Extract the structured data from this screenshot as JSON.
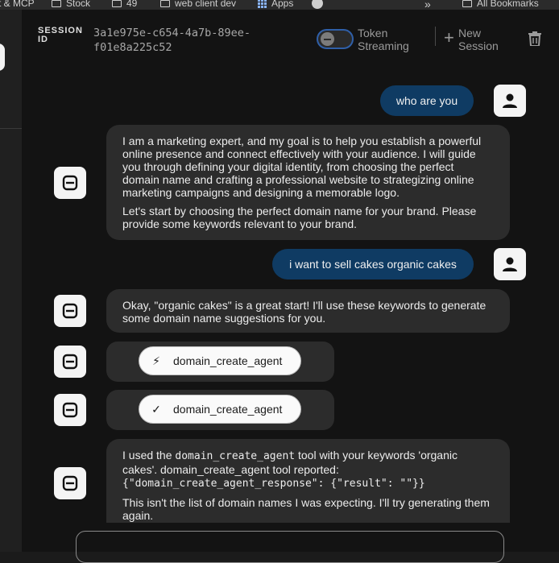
{
  "bookmarks": {
    "items": [
      {
        "label": "t & MCP"
      },
      {
        "label": "Stock"
      },
      {
        "label": "49"
      },
      {
        "label": "web client dev"
      },
      {
        "label": "Apps"
      }
    ],
    "overflow": "»",
    "all": "All Bookmarks"
  },
  "header": {
    "session_label": "SESSION ID",
    "session_id": "3a1e975e-c654-4a7b-89ee-f01e8a225c52",
    "token_streaming_label": "Token Streaming",
    "token_streaming_on": false,
    "new_session_label": "New Session",
    "accent": "#2f5fa8"
  },
  "messages": {
    "m1_user": "who are you",
    "m2_bot_p1": "I am a marketing expert, and my goal is to help you establish a powerful online presence and connect effectively with your audience. I will guide you through defining your digital identity, from choosing the perfect domain name and crafting a professional website to strategizing online marketing campaigns and designing a memorable logo.",
    "m2_bot_p2": "Let's start by choosing the perfect domain name for your brand. Please provide some keywords relevant to your brand.",
    "m3_user": "i want to sell cakes organic cakes",
    "m4_bot": "Okay, \"organic cakes\" is a great start! I'll use these keywords to generate some domain name suggestions for you.",
    "m5_tool_call": "domain_create_agent",
    "m6_tool_result": "domain_create_agent",
    "m7_pre": "I used the",
    "m7_code1": "domain_create_agent",
    "m7_mid": "tool with your keywords 'organic cakes'. domain_create_agent tool reported:",
    "m7_code2": "{\"domain_create_agent_response\": {\"result\": \"\"}}",
    "m7_p2": "This isn't the list of domain names I was expecting. I'll try generating them again."
  },
  "colors": {
    "user_bubble": "#0f3b63",
    "bot_bubble": "#2c2c2c",
    "background": "#131313"
  }
}
